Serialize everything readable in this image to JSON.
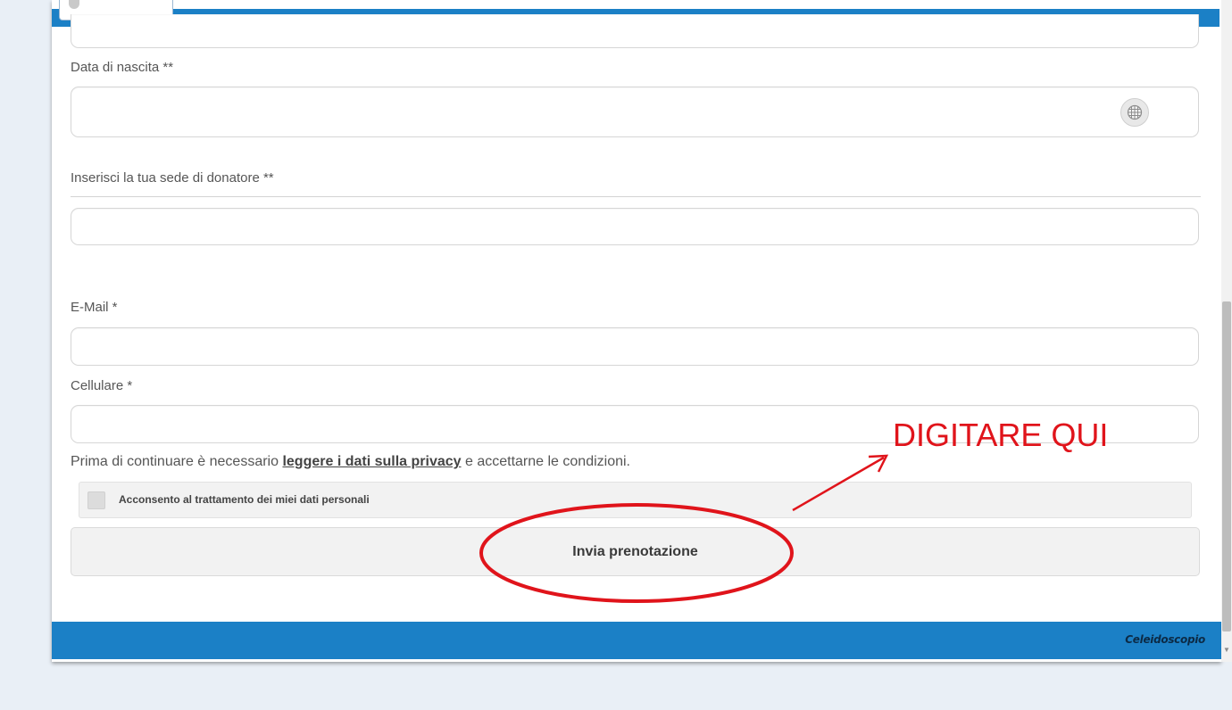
{
  "form": {
    "birthdate_label": "Data di nascita **",
    "donor_site_label": "Inserisci la tua sede di donatore **",
    "email_label": "E-Mail *",
    "mobile_label": "Cellulare *",
    "privacy_text_before": "Prima di continuare è necessario ",
    "privacy_link": "leggere i dati sulla privacy",
    "privacy_text_after": " e accettarne le condizioni.",
    "consent_label": "Acconsento al trattamento dei miei dati personali",
    "consent_checked": false,
    "submit_label": "Invia prenotazione"
  },
  "footer": {
    "brand": "Celeidoscopio"
  },
  "annotation": {
    "text": "DIGITARE QUI",
    "color": "#e0141b"
  },
  "colors": {
    "brand_blue": "#1b80c6",
    "page_bg": "#e9eff6"
  }
}
